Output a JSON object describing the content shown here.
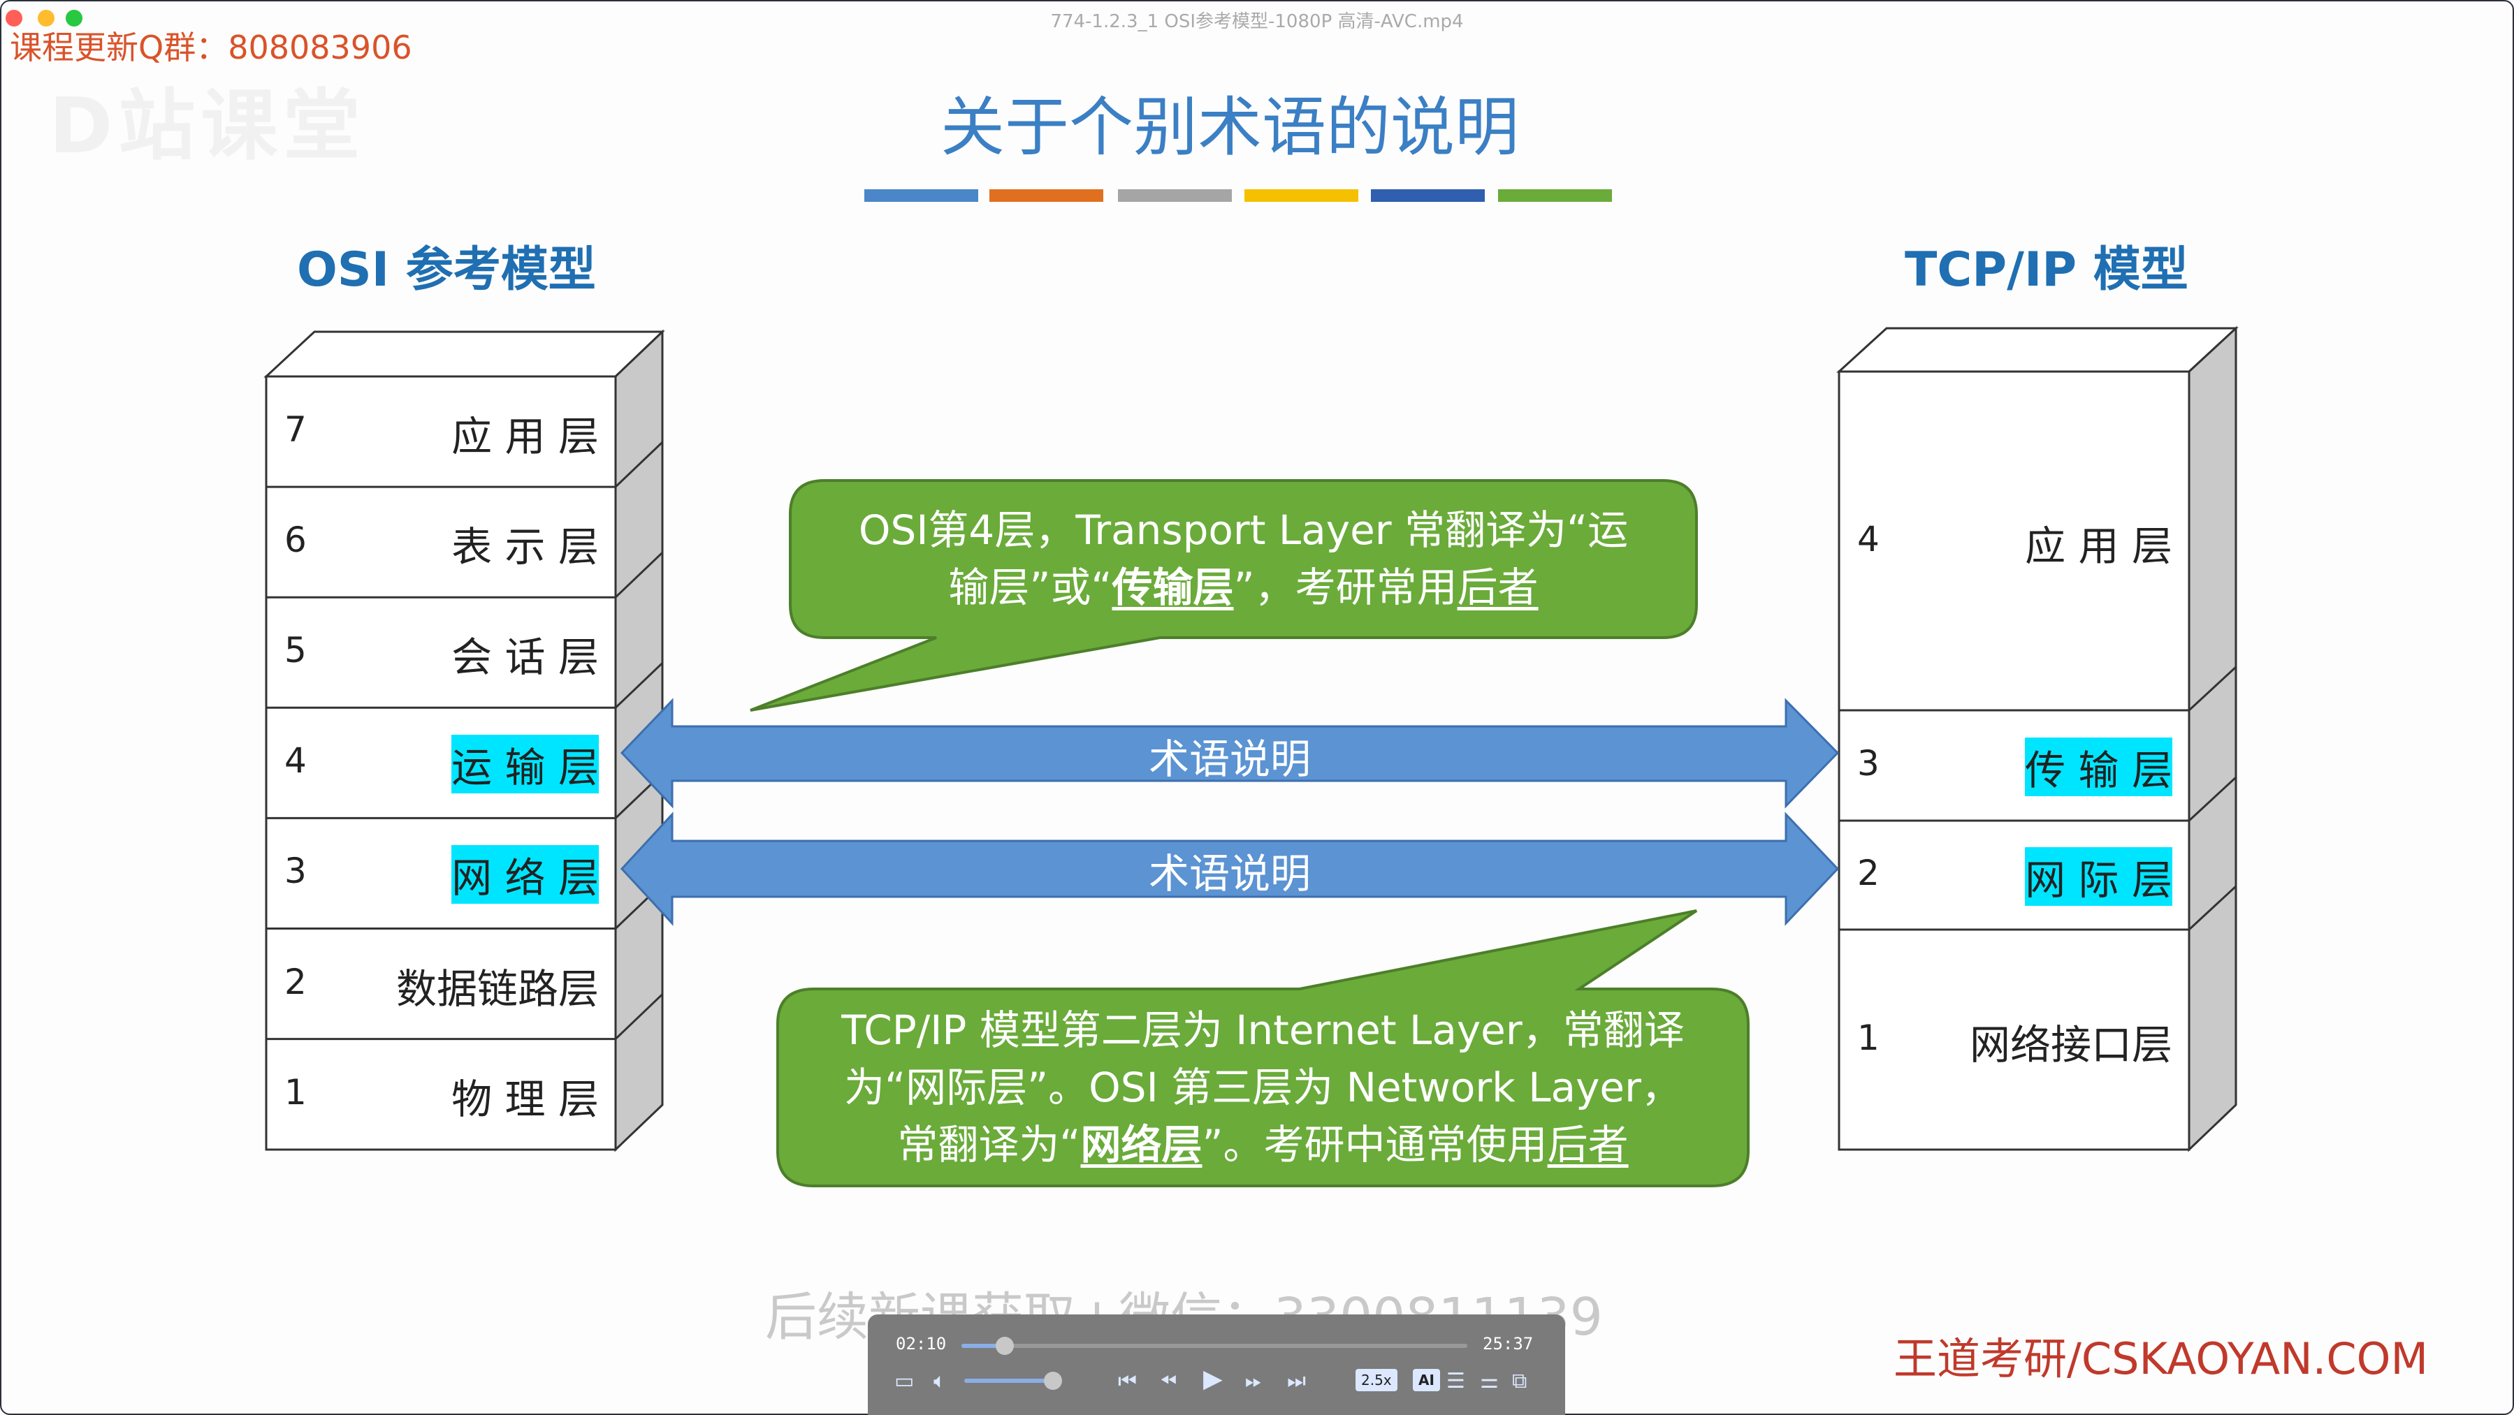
{
  "window": {
    "file_title": "774-1.2.3_1 OSI参考模型-1080P 高清-AVC.mp4",
    "qq_group": "课程更新Q群：808083906",
    "logo": "D站课堂"
  },
  "slide": {
    "title": "关于个别术语的说明",
    "bar_colors": [
      "#4a86c8",
      "#e07020",
      "#a5a5a5",
      "#f5c000",
      "#2f5fae",
      "#6aab3a"
    ],
    "osi": {
      "label": "OSI 参考模型",
      "layers": [
        {
          "num": "7",
          "name": "应 用 层",
          "highlight": false
        },
        {
          "num": "6",
          "name": "表 示 层",
          "highlight": false
        },
        {
          "num": "5",
          "name": "会 话 层",
          "highlight": false
        },
        {
          "num": "4",
          "name": "运 输 层",
          "highlight": true
        },
        {
          "num": "3",
          "name": "网 络 层",
          "highlight": true
        },
        {
          "num": "2",
          "name": "数据链路层",
          "highlight": false
        },
        {
          "num": "1",
          "name": "物 理 层",
          "highlight": false
        }
      ]
    },
    "tcpip": {
      "label": "TCP/IP 模型",
      "layers": [
        {
          "num": "4",
          "name": "应 用 层",
          "highlight": false
        },
        {
          "num": "3",
          "name": "传 输 层",
          "highlight": true
        },
        {
          "num": "2",
          "name": "网 际 层",
          "highlight": true
        },
        {
          "num": "1",
          "name": "网络接口层",
          "highlight": false
        }
      ]
    },
    "arrows": [
      "术语说明",
      "术语说明"
    ],
    "callout1": {
      "a": "OSI第4层，Transport Layer 常翻译为“运",
      "b": "输层”或“",
      "c": "传输层",
      "d": "”，考研常用",
      "e": "后者"
    },
    "callout2": {
      "a": "TCP/IP 模型第二层为 Internet Layer，常翻译",
      "b": "为“网际层”。OSI 第三层为 Network Layer，",
      "c": "常翻译为“",
      "d": "网络层",
      "e": "”。考研中通常使用",
      "f": "后者"
    },
    "watermark": "后续新课获取+微信：3300811139",
    "brand": "王道考研/CSKAOYAN.COM"
  },
  "player": {
    "current": "02:10",
    "total": "25:37",
    "progress": 0.085,
    "volume": 1.0,
    "speed": "2.5x",
    "ai": "AI"
  }
}
